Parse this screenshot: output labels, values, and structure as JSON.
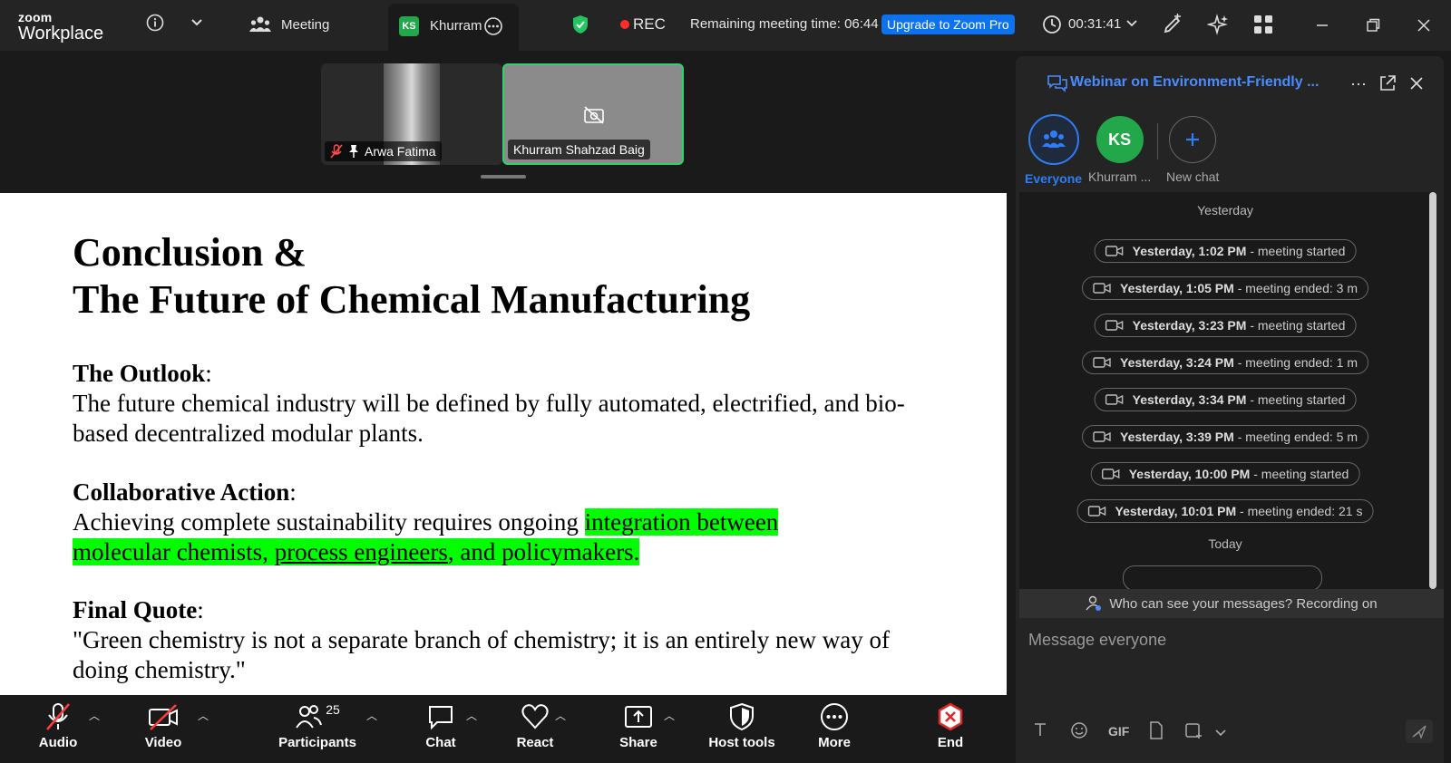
{
  "app": {
    "logo_line1": "zoom",
    "logo_line2": "Workplace"
  },
  "topbar": {
    "meeting_tab": "Meeting",
    "user_tab": "Khurram",
    "user_initials": "KS",
    "rec_label": "REC",
    "remaining_time": "Remaining meeting time: 06:44",
    "upgrade_label": "Upgrade to Zoom Pro",
    "elapsed": "00:31:41"
  },
  "filmstrip": {
    "tiles": [
      {
        "name": "Arwa Fatima"
      },
      {
        "name": "Khurram Shahzad Baig"
      }
    ]
  },
  "slide": {
    "title_line1": "Conclusion &",
    "title_line2": "The Future of Chemical Manufacturing",
    "outlook_heading": "The Outlook",
    "outlook_body": "The future chemical industry will be defined by fully automated, electrified, and bio-based decentralized modular plants.",
    "collab_heading": "Collaborative Action",
    "collab_pre": "Achieving complete sustainability requires ongoing ",
    "collab_hl1": "integration between",
    "collab_hl2a": "molecular chemists, ",
    "collab_hl2b": "process engineers",
    "collab_hl2c": ", and policymakers.",
    "quote_heading": "Final Quote",
    "quote_body": "\"Green chemistry is not a separate branch of chemistry; it is an entirely new way of doing chemistry.\""
  },
  "toolbar": {
    "audio": "Audio",
    "video": "Video",
    "participants": "Participants",
    "participants_count": "25",
    "chat": "Chat",
    "react": "React",
    "share": "Share",
    "host_tools": "Host tools",
    "more": "More",
    "end": "End"
  },
  "chat": {
    "title": "Webinar on Environment-Friendly ...",
    "chips": [
      {
        "label": "Everyone"
      },
      {
        "label": "Khurram ...",
        "initials": "KS"
      },
      {
        "label": "New chat"
      }
    ],
    "day_yesterday": "Yesterday",
    "day_today": "Today",
    "messages": [
      {
        "time": "Yesterday, 1:02 PM",
        "text": " - meeting started"
      },
      {
        "time": "Yesterday, 1:05 PM",
        "text": " - meeting ended: 3 m"
      },
      {
        "time": "Yesterday, 3:23 PM",
        "text": " - meeting started"
      },
      {
        "time": "Yesterday, 3:24 PM",
        "text": " - meeting ended: 1 m"
      },
      {
        "time": "Yesterday, 3:34 PM",
        "text": " - meeting started"
      },
      {
        "time": "Yesterday, 3:39 PM",
        "text": " - meeting ended: 5 m"
      },
      {
        "time": "Yesterday, 10:00 PM",
        "text": " - meeting started"
      },
      {
        "time": "Yesterday, 10:01 PM",
        "text": " - meeting ended: 21 s"
      }
    ],
    "notice": "Who can see your messages? Recording on",
    "input_placeholder": "Message everyone",
    "gif_label": "GIF"
  },
  "colors": {
    "accent": "#0e72ed",
    "green": "#22a84a",
    "highlight": "#00ff00",
    "end_red": "#e02828"
  }
}
